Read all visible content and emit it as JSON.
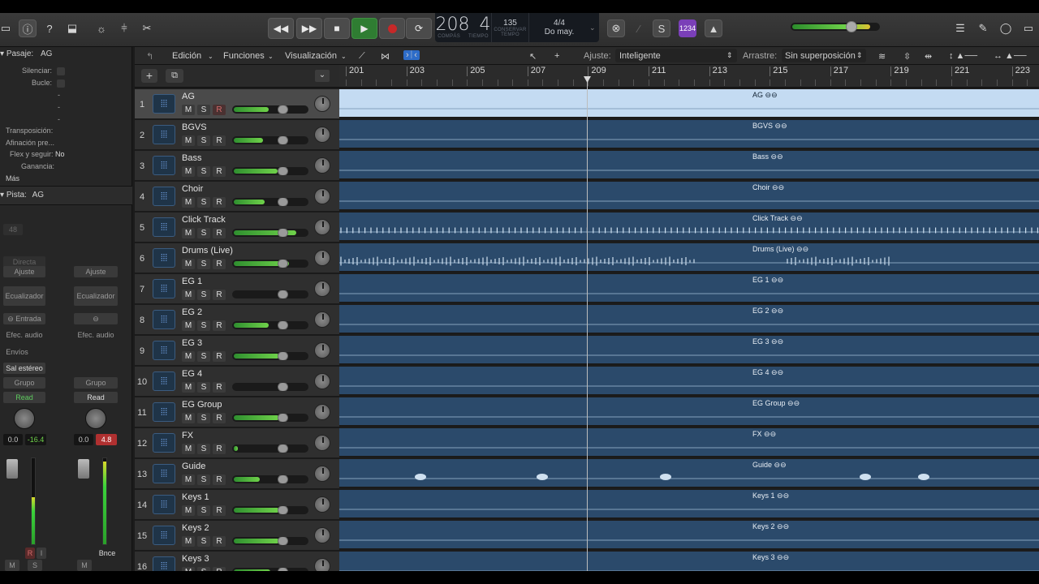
{
  "transport": {
    "bar": "208",
    "beat": "4",
    "bar_caption": "COMPÁS",
    "beat_caption": "TIEMPO",
    "tempo": "135",
    "tempo_mode": "CONSERVAR",
    "tempo_caption": "TEMPO",
    "signature": "4/4",
    "key": "Do may.",
    "count_in": "1234",
    "accent": "#7a3fb8"
  },
  "edit_menu": {
    "edit": "Edición",
    "functions": "Funciones",
    "view": "Visualización",
    "snap_label": "Ajuste:",
    "snap_value": "Inteligente",
    "drag_label": "Arrastre:",
    "drag_value": "Sin superposición"
  },
  "inspector": {
    "region_header": "Pasaje:",
    "region_name": "AG",
    "mute_label": "Silenciar:",
    "loop_label": "Bucle:",
    "dash1": "-",
    "dash2": "-",
    "dash3": "-",
    "transpose_label": "Transposición:",
    "fine_tune_label": "Afinación pre...",
    "flex_label": "Flex y seguir:",
    "flex_value": "No",
    "gain_label": "Ganancia:",
    "more": "Más",
    "track_header": "Pista:",
    "track_name": "AG",
    "strip1": {
      "value": "48",
      "mode": "Directa",
      "setting": "Ajuste",
      "eq": "Ecualizador",
      "input": "Entrada",
      "audio_fx": "Efec. audio",
      "sends": "Envíos",
      "output": "Sal estéreo",
      "group": "Grupo",
      "automation": "Read",
      "volume": "0.0",
      "peak": "-16.4",
      "rec": "R",
      "input_monitor": "I",
      "mute": "M",
      "solo": "S"
    },
    "strip2": {
      "setting": "Ajuste",
      "eq": "Ecualizador",
      "audio_fx": "Efec. audio",
      "group": "Grupo",
      "automation": "Read",
      "volume": "0.0",
      "peak": "4.8",
      "name": "Bnce",
      "mute": "M"
    }
  },
  "ruler": {
    "bars": [
      "201",
      "203",
      "205",
      "207",
      "209",
      "211",
      "213",
      "215",
      "217",
      "219",
      "221",
      "223"
    ]
  },
  "tracks": [
    {
      "num": "1",
      "name": "AG",
      "m": "M",
      "s": "S",
      "r": "R",
      "level": 0.48,
      "fader": 0.66
    },
    {
      "num": "2",
      "name": "BGVS",
      "m": "M",
      "s": "S",
      "r": "R",
      "level": 0.4,
      "fader": 0.66
    },
    {
      "num": "3",
      "name": "Bass",
      "m": "M",
      "s": "S",
      "r": "R",
      "level": 0.6,
      "fader": 0.66
    },
    {
      "num": "4",
      "name": "Choir",
      "m": "M",
      "s": "S",
      "r": "R",
      "level": 0.42,
      "fader": 0.66
    },
    {
      "num": "5",
      "name": "Click Track",
      "m": "M",
      "s": "S",
      "r": "R",
      "level": 0.85,
      "fader": 0.66
    },
    {
      "num": "6",
      "name": "Drums (Live)",
      "m": "M",
      "s": "S",
      "r": "R",
      "level": 0.75,
      "fader": 0.66
    },
    {
      "num": "7",
      "name": "EG 1",
      "m": "M",
      "s": "S",
      "r": "R",
      "level": 0,
      "fader": 0.66
    },
    {
      "num": "8",
      "name": "EG 2",
      "m": "M",
      "s": "S",
      "r": "R",
      "level": 0.48,
      "fader": 0.66
    },
    {
      "num": "9",
      "name": "EG 3",
      "m": "M",
      "s": "S",
      "r": "R",
      "level": 0.62,
      "fader": 0.66
    },
    {
      "num": "10",
      "name": "EG 4",
      "m": "M",
      "s": "S",
      "r": "R",
      "level": 0,
      "fader": 0.66
    },
    {
      "num": "11",
      "name": "EG Group",
      "m": "M",
      "s": "S",
      "r": "R",
      "level": 0.62,
      "fader": 0.66
    },
    {
      "num": "12",
      "name": "FX",
      "m": "M",
      "s": "S",
      "r": "R",
      "level": 0.06,
      "fader": 0.66
    },
    {
      "num": "13",
      "name": "Guide",
      "m": "M",
      "s": "S",
      "r": "R",
      "level": 0.36,
      "fader": 0.66
    },
    {
      "num": "14",
      "name": "Keys 1",
      "m": "M",
      "s": "S",
      "r": "R",
      "level": 0.62,
      "fader": 0.66
    },
    {
      "num": "15",
      "name": "Keys 2",
      "m": "M",
      "s": "S",
      "r": "R",
      "level": 0.62,
      "fader": 0.66
    },
    {
      "num": "16",
      "name": "Keys 3",
      "m": "M",
      "s": "S",
      "r": "R",
      "level": 0.5,
      "fader": 0.66
    }
  ],
  "colors": {
    "region": "#2b4a6b",
    "region_selected": "#c4dbf2",
    "level": "#6fd24a",
    "record": "#c62828",
    "play": "#2f7d32"
  }
}
